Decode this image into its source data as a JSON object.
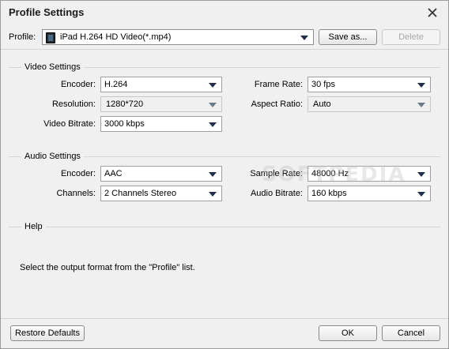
{
  "window": {
    "title": "Profile Settings",
    "close_icon": "close-icon"
  },
  "toolbar": {
    "profile_label": "Profile:",
    "profile_value": "iPad H.264 HD Video(*.mp4)",
    "save_as_label": "Save as...",
    "delete_label": "Delete"
  },
  "video": {
    "section_title": "Video Settings",
    "encoder_label": "Encoder:",
    "encoder_value": "H.264",
    "resolution_label": "Resolution:",
    "resolution_value": "1280*720",
    "bitrate_label": "Video Bitrate:",
    "bitrate_value": "3000 kbps",
    "frame_rate_label": "Frame Rate:",
    "frame_rate_value": "30 fps",
    "aspect_label": "Aspect Ratio:",
    "aspect_value": "Auto"
  },
  "audio": {
    "section_title": "Audio Settings",
    "encoder_label": "Encoder:",
    "encoder_value": "AAC",
    "channels_label": "Channels:",
    "channels_value": "2 Channels Stereo",
    "sample_rate_label": "Sample Rate:",
    "sample_rate_value": "48000 Hz",
    "bitrate_label": "Audio Bitrate:",
    "bitrate_value": "160 kbps"
  },
  "help": {
    "section_title": "Help",
    "text": "Select the output format from the \"Profile\" list."
  },
  "footer": {
    "restore_label": "Restore Defaults",
    "ok_label": "OK",
    "cancel_label": "Cancel"
  },
  "watermark": "SOFTPEDIA"
}
